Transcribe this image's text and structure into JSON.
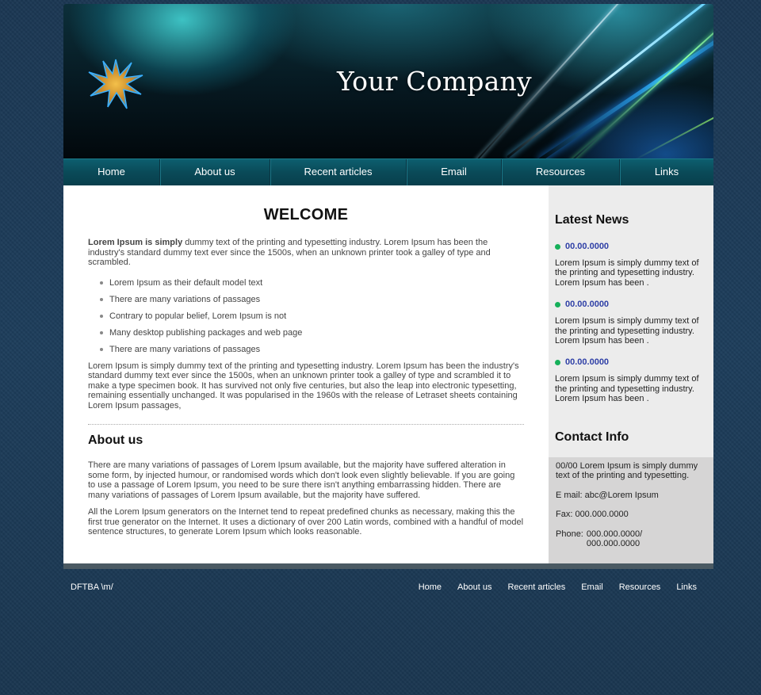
{
  "header": {
    "company_name": "Your Company",
    "logo_icon": "starburst-icon"
  },
  "nav": {
    "items": [
      {
        "label": "Home",
        "width": 122
      },
      {
        "label": "About us",
        "width": 139
      },
      {
        "label": "Recent articles",
        "width": 172
      },
      {
        "label": "Email",
        "width": 120
      },
      {
        "label": "Resources",
        "width": 149
      },
      {
        "label": "Links",
        "width": 118
      }
    ]
  },
  "main": {
    "title": "WELCOME",
    "intro_bold": "Lorem Ipsum is simply",
    "intro_rest": " dummy text of the printing and typesetting industry. Lorem Ipsum has been the industry's standard dummy text ever since the 1500s, when an unknown printer took a galley of type and scrambled.",
    "bullets": [
      "Lorem Ipsum as their default model text",
      "There are many variations of passages",
      "Contrary to popular belief, Lorem Ipsum is not",
      "Many desktop publishing packages and web page",
      "There are many variations of passages"
    ],
    "paragraph": "Lorem Ipsum is simply dummy text of the printing and typesetting industry. Lorem Ipsum has been the industry's standard dummy text ever since the 1500s, when an unknown printer took a galley of type and scrambled it to make a type specimen book. It has survived not only five centuries, but also the leap into electronic typesetting, remaining essentially unchanged. It was popularised in the 1960s with the release of Letraset sheets containing Lorem Ipsum passages,",
    "about_title": "About us",
    "about_p1": "There are many variations of passages of Lorem Ipsum available, but the majority have suffered alteration in some form, by injected humour, or randomised words which don't look even slightly believable. If you are going to use a passage of Lorem Ipsum, you need to be sure there isn't anything embarrassing hidden. There are many variations of passages of Lorem Ipsum available, but the majority have suffered.",
    "about_p2": "All the Lorem Ipsum generators on the Internet tend to repeat predefined chunks as necessary, making this the first true generator on the Internet. It uses a dictionary of over 200 Latin words, combined with a handful of model sentence structures, to generate Lorem Ipsum which looks reasonable."
  },
  "sidebar": {
    "latest_title": "Latest News",
    "news": [
      {
        "date": "00.00.0000",
        "text": "Lorem Ipsum is simply dummy text of the printing and typesetting industry. Lorem Ipsum has been ."
      },
      {
        "date": "00.00.0000",
        "text": "Lorem Ipsum is simply dummy text of the printing and typesetting industry. Lorem Ipsum has been ."
      },
      {
        "date": "00.00.0000",
        "text": "Lorem Ipsum is simply dummy text of the printing and typesetting industry. Lorem Ipsum has been ."
      }
    ],
    "contact_title": "Contact Info",
    "contact_address": "00/00 Lorem Ipsum is simply dummy text of the printing and typesetting.",
    "contact_email": "E mail: abc@Lorem Ipsum",
    "contact_fax": "Fax: 000.000.0000",
    "contact_phone_label": "Phone:",
    "contact_phone_1": "000.000.0000/",
    "contact_phone_2": "000.000.0000"
  },
  "footer": {
    "copyright": "DFTBA \\m/",
    "links": [
      "Home",
      "About us",
      "Recent articles",
      "Email",
      "Resources",
      "Links"
    ]
  },
  "colors": {
    "accent_dot": "#16b05a",
    "date_text": "#2e3fa6",
    "nav_bg": "#0a4a58",
    "page_bg": "#1c3a55"
  }
}
